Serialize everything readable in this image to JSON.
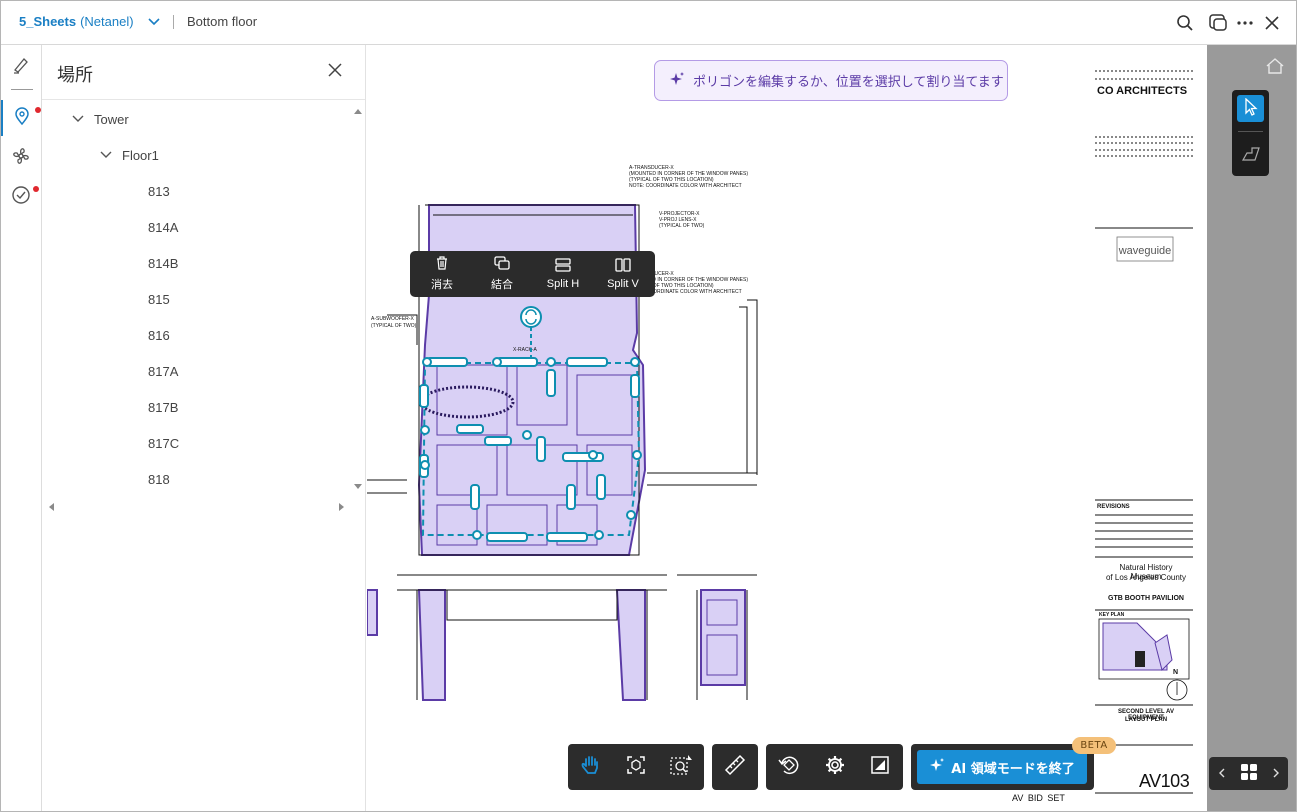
{
  "topbar": {
    "project_name": "5_Sheets",
    "project_owner": "(Netanel)",
    "sheet_name": "Bottom floor"
  },
  "panel": {
    "title": "場所",
    "tree": [
      {
        "label": "Tower",
        "level": 0,
        "expanded": true
      },
      {
        "label": "Floor1",
        "level": 1,
        "expanded": true
      },
      {
        "label": "813",
        "level": 2
      },
      {
        "label": "814A",
        "level": 2
      },
      {
        "label": "814B",
        "level": 2
      },
      {
        "label": "815",
        "level": 2
      },
      {
        "label": "816",
        "level": 2
      },
      {
        "label": "817A",
        "level": 2
      },
      {
        "label": "817B",
        "level": 2
      },
      {
        "label": "817C",
        "level": 2
      },
      {
        "label": "818",
        "level": 2
      }
    ]
  },
  "canvas": {
    "hint": "ポリゴンを編集するか、位置を選択して割り当てます",
    "context_menu": {
      "delete_label": "消去",
      "merge_label": "結合",
      "split_h_label": "Split H",
      "split_v_label": "Split V"
    }
  },
  "sheet": {
    "firm": "CO ARCHITECTS",
    "logo_text": "waveguide",
    "project_line1": "Natural History Museum",
    "project_line2": "of Los Angeles County",
    "project_line3": "GTB BOOTH PAVILION",
    "drawing_title1": "SECOND LEVEL AV EQUIPMENT",
    "drawing_title2": "LAYOUT PLAN",
    "sheet_number": "AV103",
    "footer": "AV  BID  SET",
    "revisions_label": "REVISIONS",
    "key_plan_label": "KEY PLAN",
    "north_label": "N",
    "notes": [
      "A-TRANSDUCER-X",
      "(MOUNTED IN CORNER OF THE WINDOW PANES)",
      "(TYPICAL OF TWO THIS LOCATION)",
      "NOTE: COORDINATE COLOR WITH ARCHITECT",
      "V-PROJECTOR-X",
      "V-PROJ LENS-X",
      "(TYPICAL OF TWO)",
      "A-SUBWOOFER-X",
      "(TYPICAL OF TWO)",
      "X-RACK-A"
    ]
  },
  "toolbar": {
    "ai_label": "AI 領域モードを終了",
    "beta": "BETA"
  },
  "colors": {
    "accent": "#1a8fd6",
    "brand_link": "#1a7fc4",
    "polygon_fill": "#d9d0f5",
    "polygon_stroke": "#5b3ba6",
    "edit_handle": "#0e8fb0",
    "badge_red": "#e0282e"
  }
}
